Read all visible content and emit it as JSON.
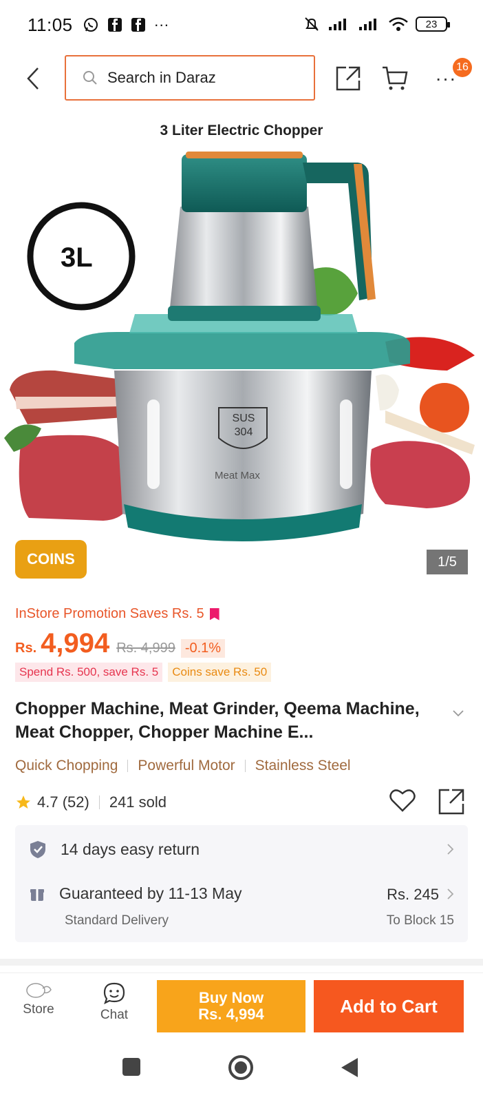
{
  "status_bar": {
    "time": "11:05",
    "battery": "23"
  },
  "header": {
    "search_placeholder": "Search in Daraz",
    "more_badge": "16"
  },
  "gallery": {
    "image_caption": "3 Liter Electric Chopper",
    "capacity_label": "3L",
    "badge_label": "SUS 304",
    "brand_mark": "Meat Max",
    "coins_label": "COINS",
    "counter": "1/5"
  },
  "promo": {
    "text": "InStore Promotion Saves Rs. 5"
  },
  "price": {
    "currency": "Rs.",
    "current": "4,994",
    "original": "Rs. 4,999",
    "discount": "-0.1%"
  },
  "chips": {
    "spend": "Spend Rs. 500, save Rs. 5",
    "coins": "Coins save Rs. 50"
  },
  "product": {
    "title": "Chopper Machine, Meat Grinder, Qeema Machine, Meat Chopper, Chopper Machine E...",
    "features": [
      "Quick Chopping",
      "Powerful Motor",
      "Stainless Steel"
    ],
    "rating": "4.7 (52)",
    "sold": "241 sold"
  },
  "service": {
    "return_text": "14 days easy return",
    "delivery_text": "Guaranteed by 11-13 May",
    "delivery_type": "Standard Delivery",
    "shipping_fee": "Rs. 245",
    "destination": "To Block 15"
  },
  "bottom_bar": {
    "store_label": "Store",
    "chat_label": "Chat",
    "buy_now_line1": "Buy Now",
    "buy_now_line2": "Rs. 4,994",
    "add_to_cart": "Add to Cart"
  },
  "colors": {
    "brand_orange": "#f6581f",
    "buy_now": "#f8a41b",
    "coins": "#e9a013",
    "feature_text": "#a06a3e"
  }
}
